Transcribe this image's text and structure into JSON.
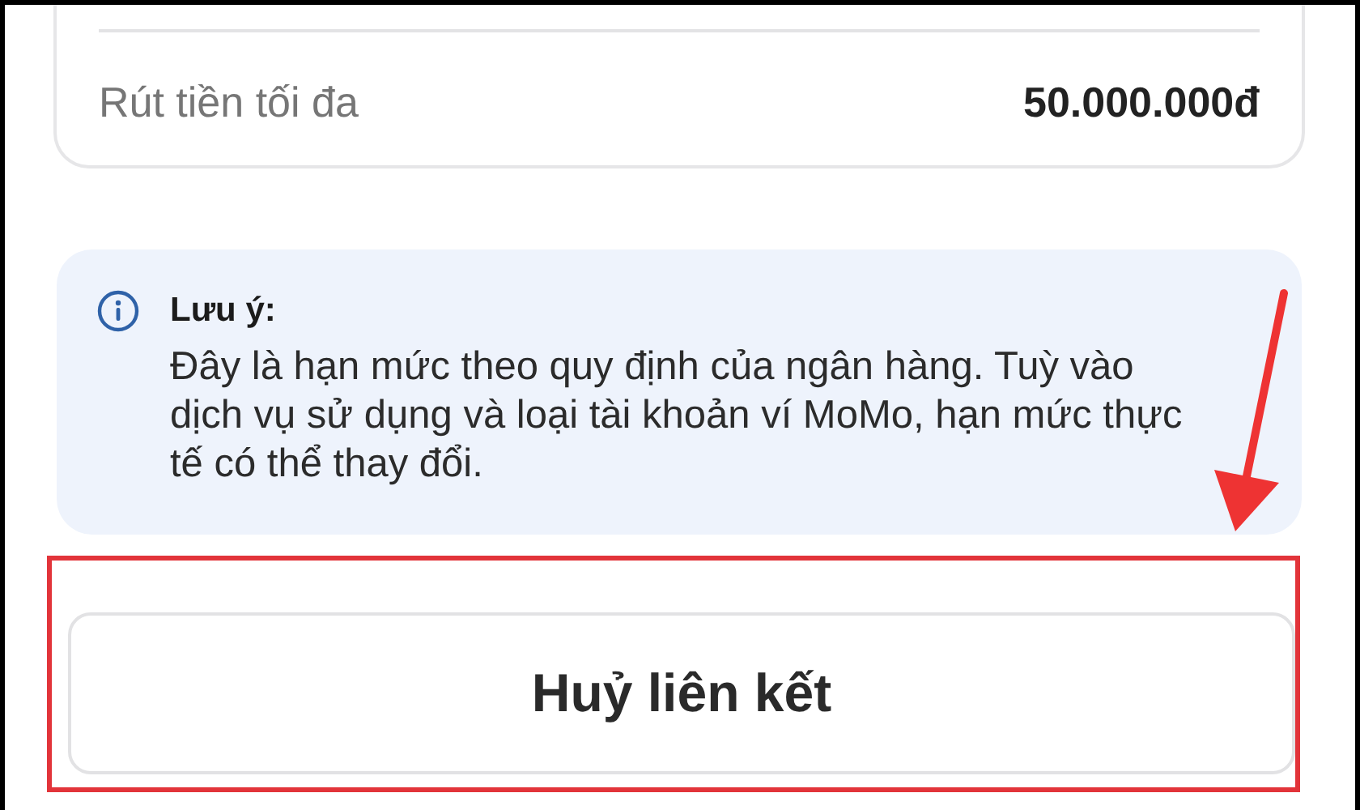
{
  "limit_card": {
    "rows": [
      {
        "label": "Rút tiền tối đa",
        "value": "50.000.000đ"
      }
    ]
  },
  "note": {
    "title": "Lưu ý:",
    "body": "Đây là hạn mức theo quy định của ngân hàng. Tuỳ vào dịch vụ sử dụng và loại tài khoản ví MoMo, hạn mức thực tế có thể thay đổi."
  },
  "unlink_button": {
    "label": "Huỷ liên kết",
    "highlighted": true
  }
}
